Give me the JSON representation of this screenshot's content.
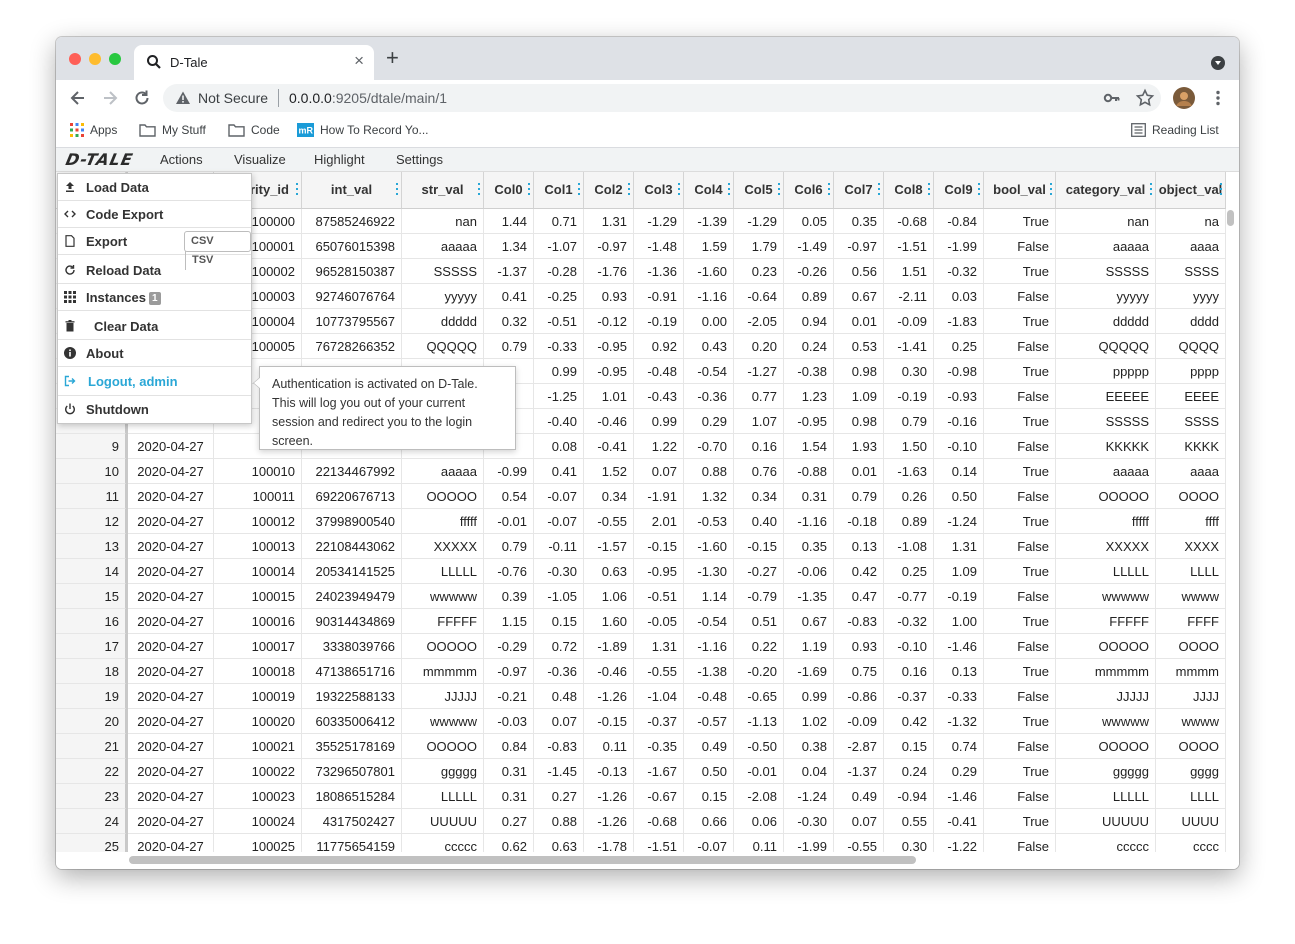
{
  "browser": {
    "tab_title": "D-Tale",
    "tab_close": "×",
    "new_tab": "+",
    "security_label": "Not Secure",
    "url_host": "0.0.0.0",
    "url_rest": ":9205/dtale/main/1",
    "bookmarks": [
      "Apps",
      "My Stuff",
      "Code",
      "How To Record Yo..."
    ],
    "reading_list": "Reading List"
  },
  "app": {
    "logo": "D-TALE",
    "menu": [
      "Actions",
      "Visualize",
      "Highlight",
      "Settings"
    ]
  },
  "dropdown": {
    "items": [
      {
        "label": "Load Data",
        "icon": "upload-icon"
      },
      {
        "label": "Code Export",
        "icon": "code-icon"
      },
      {
        "label": "Export",
        "icon": "file-icon"
      },
      {
        "label": "Reload Data",
        "icon": "refresh-icon"
      },
      {
        "label": "Instances",
        "icon": "grid-icon",
        "badge": "1"
      },
      {
        "label": "Clear Data",
        "icon": "trash-icon"
      },
      {
        "label": "About",
        "icon": "info-icon"
      },
      {
        "label": "Logout, admin",
        "icon": "logout-icon"
      },
      {
        "label": "Shutdown",
        "icon": "power-icon"
      }
    ],
    "export_buttons": [
      "CSV",
      "TSV"
    ]
  },
  "tooltip": {
    "text": "Authentication is activated on D-Tale. This will log you out of your current session and redirect you to the login screen."
  },
  "grid": {
    "headers": [
      "",
      "",
      "urity_id",
      "int_val",
      "str_val",
      "Col0",
      "Col1",
      "Col2",
      "Col3",
      "Col4",
      "Col5",
      "Col6",
      "Col7",
      "Col8",
      "Col9",
      "bool_val",
      "category_val",
      "object_val"
    ],
    "rows": [
      [
        "",
        "",
        "100000",
        "87585246922",
        "nan",
        "1.44",
        "0.71",
        "1.31",
        "-1.29",
        "-1.39",
        "-1.29",
        "0.05",
        "0.35",
        "-0.68",
        "-0.84",
        "True",
        "nan",
        "na"
      ],
      [
        "",
        "",
        "100001",
        "65076015398",
        "aaaaa",
        "1.34",
        "-1.07",
        "-0.97",
        "-1.48",
        "1.59",
        "1.79",
        "-1.49",
        "-0.97",
        "-1.51",
        "-1.99",
        "False",
        "aaaaa",
        "aaaa"
      ],
      [
        "",
        "",
        "100002",
        "96528150387",
        "SSSSS",
        "-1.37",
        "-0.28",
        "-1.76",
        "-1.36",
        "-1.60",
        "0.23",
        "-0.26",
        "0.56",
        "1.51",
        "-0.32",
        "True",
        "SSSSS",
        "SSSS"
      ],
      [
        "",
        "",
        "100003",
        "92746076764",
        "yyyyy",
        "0.41",
        "-0.25",
        "0.93",
        "-0.91",
        "-1.16",
        "-0.64",
        "0.89",
        "0.67",
        "-2.11",
        "0.03",
        "False",
        "yyyyy",
        "yyyy"
      ],
      [
        "",
        "",
        "100004",
        "10773795567",
        "ddddd",
        "0.32",
        "-0.51",
        "-0.12",
        "-0.19",
        "0.00",
        "-2.05",
        "0.94",
        "0.01",
        "-0.09",
        "-1.83",
        "True",
        "ddddd",
        "dddd"
      ],
      [
        "",
        "",
        "100005",
        "76728266352",
        "QQQQQ",
        "0.79",
        "-0.33",
        "-0.95",
        "0.92",
        "0.43",
        "0.20",
        "0.24",
        "0.53",
        "-1.41",
        "0.25",
        "False",
        "QQQQQ",
        "QQQQ"
      ],
      [
        "",
        "",
        "",
        "",
        "",
        "",
        "0.99",
        "-0.95",
        "-0.48",
        "-0.54",
        "-1.27",
        "-0.38",
        "0.98",
        "0.30",
        "-0.98",
        "True",
        "ppppp",
        "pppp"
      ],
      [
        "",
        "",
        "",
        "",
        "",
        "",
        "-1.25",
        "1.01",
        "-0.43",
        "-0.36",
        "0.77",
        "1.23",
        "1.09",
        "-0.19",
        "-0.93",
        "False",
        "EEEEE",
        "EEEE"
      ],
      [
        "",
        "",
        "",
        "",
        "",
        "",
        "-0.40",
        "-0.46",
        "0.99",
        "0.29",
        "1.07",
        "-0.95",
        "0.98",
        "0.79",
        "-0.16",
        "True",
        "SSSSS",
        "SSSS"
      ],
      [
        "9",
        "2020-04-27",
        "",
        "",
        "",
        "",
        "0.08",
        "-0.41",
        "1.22",
        "-0.70",
        "0.16",
        "1.54",
        "1.93",
        "1.50",
        "-0.10",
        "False",
        "KKKKK",
        "KKKK"
      ],
      [
        "10",
        "2020-04-27",
        "100010",
        "22134467992",
        "aaaaa",
        "-0.99",
        "0.41",
        "1.52",
        "0.07",
        "0.88",
        "0.76",
        "-0.88",
        "0.01",
        "-1.63",
        "0.14",
        "True",
        "aaaaa",
        "aaaa"
      ],
      [
        "11",
        "2020-04-27",
        "100011",
        "69220676713",
        "OOOOO",
        "0.54",
        "-0.07",
        "0.34",
        "-1.91",
        "1.32",
        "0.34",
        "0.31",
        "0.79",
        "0.26",
        "0.50",
        "False",
        "OOOOO",
        "OOOO"
      ],
      [
        "12",
        "2020-04-27",
        "100012",
        "37998900540",
        "fffff",
        "-0.01",
        "-0.07",
        "-0.55",
        "2.01",
        "-0.53",
        "0.40",
        "-1.16",
        "-0.18",
        "0.89",
        "-1.24",
        "True",
        "fffff",
        "ffff"
      ],
      [
        "13",
        "2020-04-27",
        "100013",
        "22108443062",
        "XXXXX",
        "0.79",
        "-0.11",
        "-1.57",
        "-0.15",
        "-1.60",
        "-0.15",
        "0.35",
        "0.13",
        "-1.08",
        "1.31",
        "False",
        "XXXXX",
        "XXXX"
      ],
      [
        "14",
        "2020-04-27",
        "100014",
        "20534141525",
        "LLLLL",
        "-0.76",
        "-0.30",
        "0.63",
        "-0.95",
        "-1.30",
        "-0.27",
        "-0.06",
        "0.42",
        "0.25",
        "1.09",
        "True",
        "LLLLL",
        "LLLL"
      ],
      [
        "15",
        "2020-04-27",
        "100015",
        "24023949479",
        "wwwww",
        "0.39",
        "-1.05",
        "1.06",
        "-0.51",
        "1.14",
        "-0.79",
        "-1.35",
        "0.47",
        "-0.77",
        "-0.19",
        "False",
        "wwwww",
        "wwww"
      ],
      [
        "16",
        "2020-04-27",
        "100016",
        "90314434869",
        "FFFFF",
        "1.15",
        "0.15",
        "1.60",
        "-0.05",
        "-0.54",
        "0.51",
        "0.67",
        "-0.83",
        "-0.32",
        "1.00",
        "True",
        "FFFFF",
        "FFFF"
      ],
      [
        "17",
        "2020-04-27",
        "100017",
        "3338039766",
        "OOOOO",
        "-0.29",
        "0.72",
        "-1.89",
        "1.31",
        "-1.16",
        "0.22",
        "1.19",
        "0.93",
        "-0.10",
        "-1.46",
        "False",
        "OOOOO",
        "OOOO"
      ],
      [
        "18",
        "2020-04-27",
        "100018",
        "47138651716",
        "mmmmm",
        "-0.97",
        "-0.36",
        "-0.46",
        "-0.55",
        "-1.38",
        "-0.20",
        "-1.69",
        "0.75",
        "0.16",
        "0.13",
        "True",
        "mmmmm",
        "mmmm"
      ],
      [
        "19",
        "2020-04-27",
        "100019",
        "19322588133",
        "JJJJJ",
        "-0.21",
        "0.48",
        "-1.26",
        "-1.04",
        "-0.48",
        "-0.65",
        "0.99",
        "-0.86",
        "-0.37",
        "-0.33",
        "False",
        "JJJJJ",
        "JJJJ"
      ],
      [
        "20",
        "2020-04-27",
        "100020",
        "60335006412",
        "wwwww",
        "-0.03",
        "0.07",
        "-0.15",
        "-0.37",
        "-0.57",
        "-1.13",
        "1.02",
        "-0.09",
        "0.42",
        "-1.32",
        "True",
        "wwwww",
        "wwww"
      ],
      [
        "21",
        "2020-04-27",
        "100021",
        "35525178169",
        "OOOOO",
        "0.84",
        "-0.83",
        "0.11",
        "-0.35",
        "0.49",
        "-0.50",
        "0.38",
        "-2.87",
        "0.15",
        "0.74",
        "False",
        "OOOOO",
        "OOOO"
      ],
      [
        "22",
        "2020-04-27",
        "100022",
        "73296507801",
        "ggggg",
        "0.31",
        "-1.45",
        "-0.13",
        "-1.67",
        "0.50",
        "-0.01",
        "0.04",
        "-1.37",
        "0.24",
        "0.29",
        "True",
        "ggggg",
        "gggg"
      ],
      [
        "23",
        "2020-04-27",
        "100023",
        "18086515284",
        "LLLLL",
        "0.31",
        "0.27",
        "-1.26",
        "-0.67",
        "0.15",
        "-2.08",
        "-1.24",
        "0.49",
        "-0.94",
        "-1.46",
        "False",
        "LLLLL",
        "LLLL"
      ],
      [
        "24",
        "2020-04-27",
        "100024",
        "4317502427",
        "UUUUU",
        "0.27",
        "0.88",
        "-1.26",
        "-0.68",
        "0.66",
        "0.06",
        "-0.30",
        "0.07",
        "0.55",
        "-0.41",
        "True",
        "UUUUU",
        "UUUU"
      ],
      [
        "25",
        "2020-04-27",
        "100025",
        "11775654159",
        "ccccc",
        "0.62",
        "0.63",
        "-1.78",
        "-1.51",
        "-0.07",
        "0.11",
        "-1.99",
        "-0.55",
        "0.30",
        "-1.22",
        "False",
        "ccccc",
        "cccc"
      ]
    ]
  }
}
